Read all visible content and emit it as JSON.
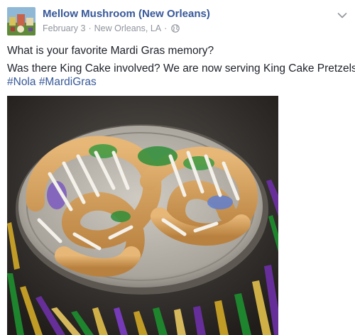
{
  "post": {
    "page_name": "Mellow Mushroom (New Orleans)",
    "date": "February 3",
    "separator": "·",
    "location": "New Orleans, LA",
    "privacy_icon": "globe-icon",
    "options_icon": "chevron-down-icon",
    "line1": "What is your favorite Mardi Gras memory?",
    "line2": "Was there King Cake involved? We are now serving King Cake Pretzels!!",
    "hashtags": [
      "#Nola",
      "#MardiGras"
    ],
    "photo_subject": "king-cake-pretzel-photo"
  },
  "colors": {
    "link": "#365899",
    "meta": "#90949c",
    "text": "#1d2129"
  }
}
